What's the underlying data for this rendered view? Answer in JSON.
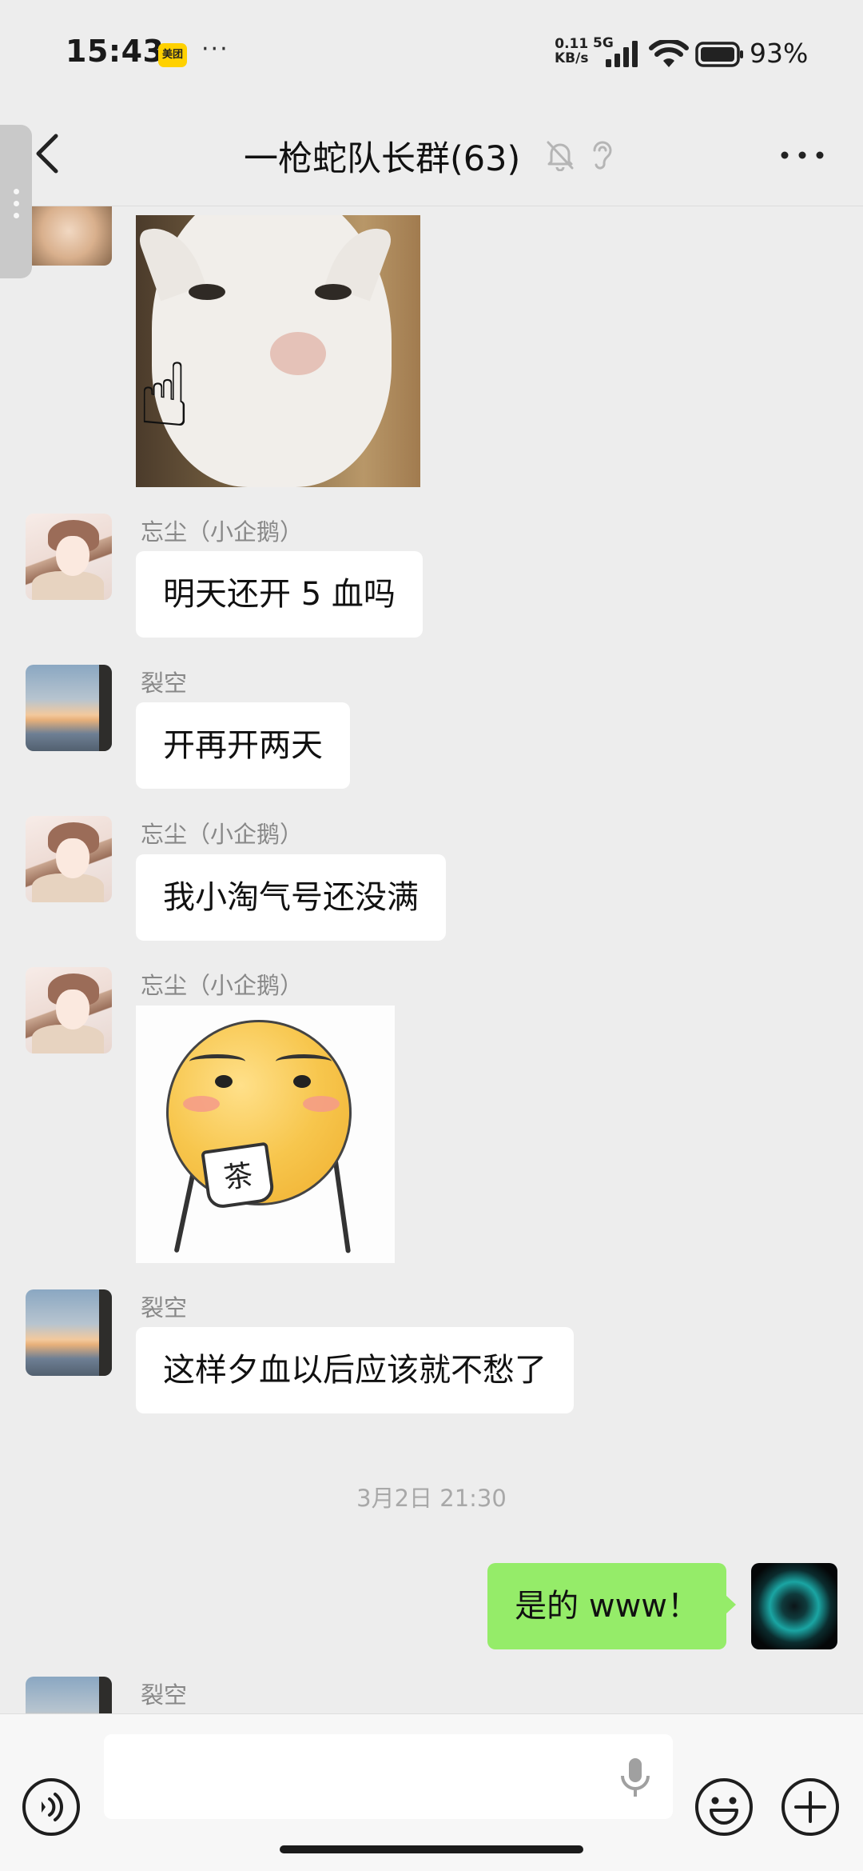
{
  "status_bar": {
    "time": "15:43",
    "app_badge": "美团",
    "more": "···",
    "net_speed_top": "0.11",
    "net_speed_bottom": "KB/s",
    "network_type": "5G",
    "battery_pct": "93%"
  },
  "header": {
    "title": "一枪蛇队长群(63)",
    "icons": [
      "back-icon",
      "mute-bell-icon",
      "earpiece-icon",
      "more-icon"
    ]
  },
  "messages": [
    {
      "kind": "image",
      "sender": "",
      "image": "cat-pointing-sticker"
    },
    {
      "kind": "text",
      "sender": "忘尘（小企鹅）",
      "text": "明天还开 5 血吗"
    },
    {
      "kind": "text",
      "sender": "裂空",
      "text": "开再开两天"
    },
    {
      "kind": "text",
      "sender": "忘尘（小企鹅）",
      "text": "我小淘气号还没满"
    },
    {
      "kind": "image",
      "sender": "忘尘（小企鹅）",
      "image": "tea-emoji-sticker",
      "sticker_text": "茶"
    },
    {
      "kind": "text",
      "sender": "裂空",
      "text": "这样夕血以后应该就不愁了"
    },
    {
      "kind": "timestamp",
      "text": "3月2日 21:30"
    },
    {
      "kind": "text",
      "sender": "me",
      "text": "是的 www！"
    },
    {
      "kind": "partial",
      "sender": "裂空"
    }
  ],
  "input_bar": {
    "icons": [
      "voice-icon",
      "mic-icon",
      "emoji-icon",
      "plus-icon"
    ],
    "placeholder": ""
  },
  "colors": {
    "background": "#ededed",
    "my_bubble": "#95ec69",
    "other_bubble": "#ffffff",
    "sender_name": "#888888"
  }
}
